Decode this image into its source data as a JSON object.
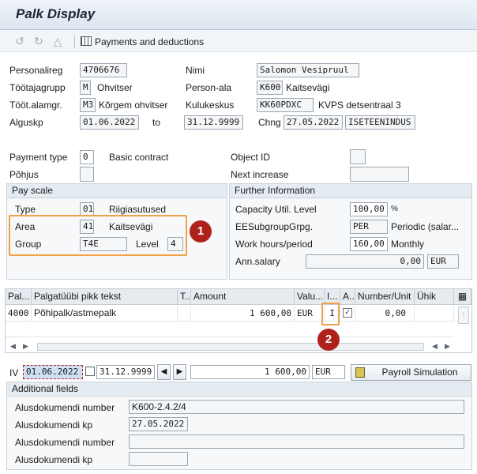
{
  "window": {
    "title": "Palk Display"
  },
  "toolbar": {
    "payments_label": "Payments and deductions"
  },
  "header": {
    "personalireg_label": "Personalireg",
    "personalireg_value": "4706676",
    "nimi_label": "Nimi",
    "nimi_value": "Salomon Vesipruul",
    "tootajagrupp_label": "Töötajagrupp",
    "tootajagrupp_code": "M",
    "tootajagrupp_text": "Ohvitser",
    "personala_label": "Person-ala",
    "personala_code": "K600",
    "personala_text": "Kaitsevägi",
    "tootalamgr_label": "Tööt.alamgr.",
    "tootalamgr_code": "M3",
    "tootalamgr_text": "Kõrgem ohvitser",
    "kulukeskus_label": "Kulukeskus",
    "kulukeskus_code": "KK60PDXC",
    "kulukeskus_text": "KVPS detsentraal 3",
    "alguskp_label": "Alguskp",
    "alguskp_value": "01.06.2022",
    "to_label": "to",
    "to_value": "31.12.9999",
    "chng_label": "Chng",
    "chng_date": "27.05.2022",
    "chng_user": "ISETEENINDUS"
  },
  "basic": {
    "payment_type_label": "Payment type",
    "payment_type_value": "0",
    "basic_contract_label": "Basic contract",
    "object_id_label": "Object ID",
    "object_id_value": "",
    "pohjus_label": "Põhjus",
    "pohjus_value": "",
    "next_increase_label": "Next increase",
    "next_increase_value": ""
  },
  "pay_scale": {
    "title": "Pay scale",
    "type_label": "Type",
    "type_code": "01",
    "type_text": "Riigiasutused",
    "area_label": "Area",
    "area_code": "41",
    "area_text": "Kaitsevägi",
    "group_label": "Group",
    "group_value": "T4E",
    "level_label": "Level",
    "level_value": "4"
  },
  "further_info": {
    "title": "Further Information",
    "capacity_label": "Capacity Util. Level",
    "capacity_value": "100,00",
    "capacity_unit": "%",
    "eesub_label": "EESubgroupGrpg.",
    "eesub_code": "PER",
    "eesub_text": "Periodic (salar...",
    "work_hours_label": "Work hours/period",
    "work_hours_value": "160,00",
    "work_hours_unit": "Monthly",
    "ann_salary_label": "Ann.salary",
    "ann_salary_value": "0,00",
    "ann_salary_currency": "EUR"
  },
  "annotations": {
    "badge1": "1",
    "badge2": "2"
  },
  "table": {
    "columns": [
      "Pal...",
      "Palgatüübi pikk tekst",
      "T..",
      "Amount",
      "Valu...",
      "I...",
      "A..",
      "Number/Unit",
      "Ühik"
    ],
    "rows": [
      {
        "wagetype": "4000",
        "text": "Põhipalk/astmepalk",
        "t": "",
        "amount": "1 600,00",
        "currency": "EUR",
        "i": "I",
        "a_checked": true,
        "number": "0,00",
        "unit": ""
      }
    ]
  },
  "footer_bar": {
    "iv_label": "IV",
    "from_date": "01.06.2022",
    "to_date": "31.12.9999",
    "amount": "1 600,00",
    "currency": "EUR",
    "payroll_button": "Payroll Simulation"
  },
  "additional": {
    "title": "Additional fields",
    "fields": [
      {
        "label": "Alusdokumendi number",
        "value": "K600-2.4.2/4"
      },
      {
        "label": "Alusdokumendi kp",
        "value": "27.05.2022"
      },
      {
        "label": "Alusdokumendi number",
        "value": ""
      },
      {
        "label": "Alusdokumendi kp",
        "value": ""
      }
    ]
  },
  "colors": {
    "accent_orange": "#f0a24b",
    "badge_red": "#b0211c",
    "panel_bg": "#f6f8fa"
  },
  "icons": [
    "back-icon",
    "forward-icon",
    "overview-icon",
    "payments-table-icon",
    "copy-icon",
    "prev-arrow-icon",
    "next-arrow-icon",
    "calculator-icon",
    "column-settings-icon"
  ]
}
